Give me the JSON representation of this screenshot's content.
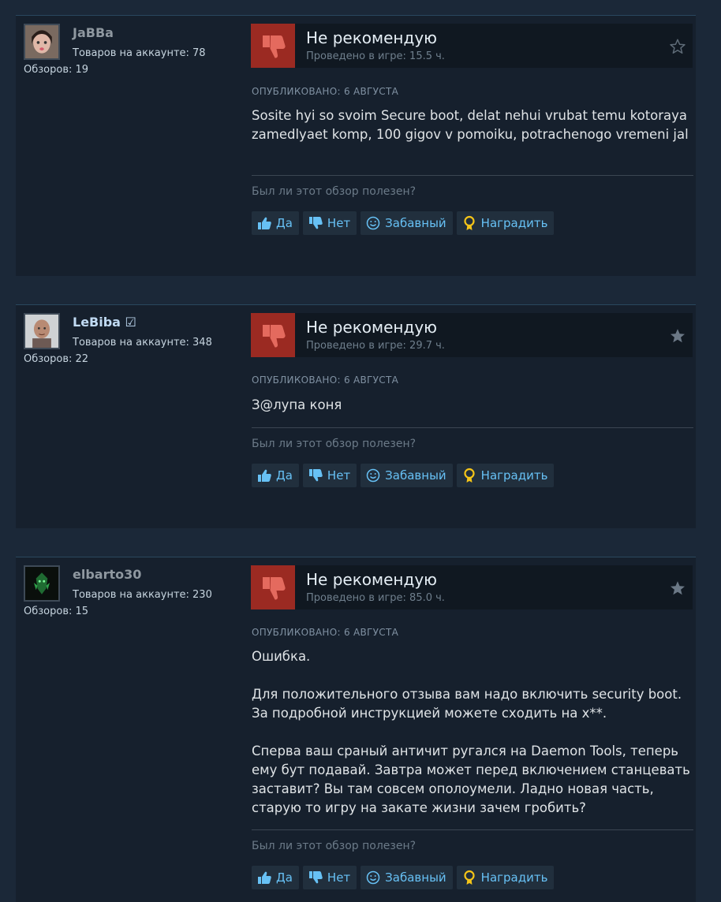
{
  "labels": {
    "products_prefix": "Товаров на аккаунте: ",
    "reviews_prefix": "Обзоров: ",
    "verdict": "Не рекомендую",
    "hours_prefix": "Проведено в игре: ",
    "helpful_question": "Был ли этот обзор полезен?",
    "btn_yes": "Да",
    "btn_no": "Нет",
    "btn_funny": "Забавный",
    "btn_award": "Наградить"
  },
  "colors": {
    "page_bg": "#1b2838",
    "card_bg": "#16202d",
    "thumb_down_bg": "#9b2a22",
    "link_blue": "#67c1f5",
    "author_name": "#c1dbf4",
    "award_gold": "#f5c518"
  },
  "reviews": [
    {
      "author": "JaBBa",
      "products": "Товаров на аккаунте: 78",
      "reviews": "Обзоров: 19",
      "verdict": "Не рекомендую",
      "hours": "Проведено в игре: 15.5 ч.",
      "posted": "ОПУБЛИКОВАНО: 6 АВГУСТА",
      "paragraphs": [
        "Sosite hyi so svoim Secure boot, delat nehui vrubat temu kotoraya zamedlyaet komp, 100 gigov v pomoiku, potrachenogo vremeni jal"
      ],
      "star_icon": "star-outline-icon"
    },
    {
      "author": "LeBiba ☑",
      "products": "Товаров на аккаунте: 348",
      "reviews": "Обзоров: 22",
      "verdict": "Не рекомендую",
      "hours": "Проведено в игре: 29.7 ч.",
      "posted": "ОПУБЛИКОВАНО: 6 АВГУСТА",
      "paragraphs": [
        "З@лупа коня"
      ],
      "star_icon": "star-filled-icon"
    },
    {
      "author": "elbarto30",
      "products": "Товаров на аккаунте: 230",
      "reviews": "Обзоров: 15",
      "verdict": "Не рекомендую",
      "hours": "Проведено в игре: 85.0 ч.",
      "posted": "ОПУБЛИКОВАНО: 6 АВГУСТА",
      "paragraphs": [
        "Ошибка.",
        "Для положительного отзыва вам надо включить security boot. За подробной инструкцией можете сходить на х**.",
        "Сперва ваш сраный античит ругался на Daemon Tools, теперь ему бут подавай. Завтра может перед включением станцевать заставит? Вы там совсем ополоумели. Ладно новая часть, старую то игру на закате жизни зачем гробить?"
      ],
      "star_icon": "star-filled-icon"
    }
  ]
}
